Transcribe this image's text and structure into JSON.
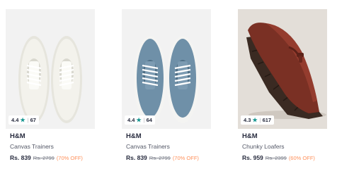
{
  "products": [
    {
      "rating": "4.4",
      "rating_count": "67",
      "brand": "H&M",
      "title": "Canvas Trainers",
      "price": "Rs. 839",
      "mrp": "Rs. 2799",
      "discount": "(70% OFF)",
      "color": "#ecebe3"
    },
    {
      "rating": "4.4",
      "rating_count": "64",
      "brand": "H&M",
      "title": "Canvas Trainers",
      "price": "Rs. 839",
      "mrp": "Rs. 2799",
      "discount": "(70% OFF)",
      "color": "#6f90a8"
    },
    {
      "rating": "4.3",
      "rating_count": "617",
      "brand": "H&M",
      "title": "Chunky Loafers",
      "price": "Rs. 959",
      "mrp": "Rs. 2399",
      "discount": "(60% OFF)",
      "color": "#7a3024"
    }
  ],
  "icons": {
    "rating_star": "star-icon"
  },
  "colors": {
    "rating_star": "#14958f",
    "discount": "#ff905a"
  }
}
